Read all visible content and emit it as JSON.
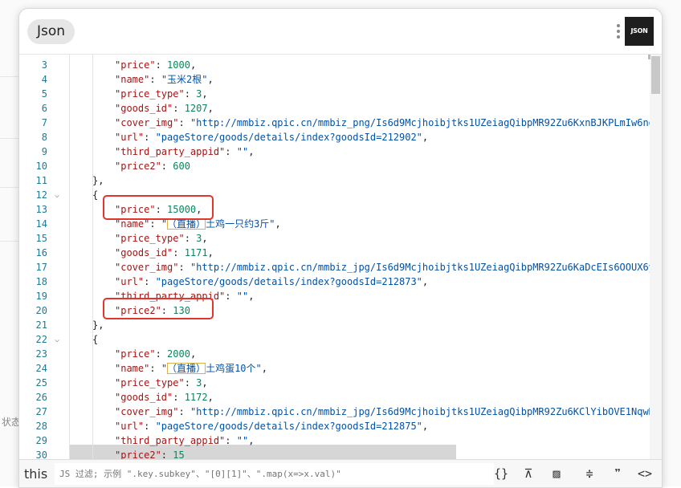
{
  "background": {
    "status_text": "状态"
  },
  "header": {
    "tab_label": "Json",
    "logo_text": "JSON"
  },
  "code_lines": [
    {
      "num": "3",
      "indent": 2,
      "tokens": [
        [
          "k",
          "\"price\""
        ],
        [
          "p",
          ": "
        ],
        [
          "n",
          "1000"
        ],
        [
          "p",
          ","
        ]
      ]
    },
    {
      "num": "4",
      "indent": 2,
      "tokens": [
        [
          "k",
          "\"name\""
        ],
        [
          "p",
          ": "
        ],
        [
          "s",
          "\"玉米2根\""
        ],
        [
          "p",
          ","
        ]
      ]
    },
    {
      "num": "5",
      "indent": 2,
      "tokens": [
        [
          "k",
          "\"price_type\""
        ],
        [
          "p",
          ": "
        ],
        [
          "n",
          "3"
        ],
        [
          "p",
          ","
        ]
      ]
    },
    {
      "num": "6",
      "indent": 2,
      "tokens": [
        [
          "k",
          "\"goods_id\""
        ],
        [
          "p",
          ": "
        ],
        [
          "n",
          "1207"
        ],
        [
          "p",
          ","
        ]
      ]
    },
    {
      "num": "7",
      "indent": 2,
      "tokens": [
        [
          "k",
          "\"cover_img\""
        ],
        [
          "p",
          ": "
        ],
        [
          "s",
          "\"http://mmbiz.qpic.cn/mmbiz_png/Is6d9Mcjhoibjtks1UZeiagQibpMR92Zu6KxnBJKPLmIw6nod"
        ]
      ]
    },
    {
      "num": "8",
      "indent": 2,
      "tokens": [
        [
          "k",
          "\"url\""
        ],
        [
          "p",
          ": "
        ],
        [
          "s",
          "\"pageStore/goods/details/index?goodsId=212902\""
        ],
        [
          "p",
          ","
        ]
      ]
    },
    {
      "num": "9",
      "indent": 2,
      "tokens": [
        [
          "k",
          "\"third_party_appid\""
        ],
        [
          "p",
          ": "
        ],
        [
          "s",
          "\"\""
        ],
        [
          "p",
          ","
        ]
      ]
    },
    {
      "num": "10",
      "indent": 2,
      "tokens": [
        [
          "k",
          "\"price2\""
        ],
        [
          "p",
          ": "
        ],
        [
          "n",
          "600"
        ]
      ]
    },
    {
      "num": "11",
      "indent": 1,
      "tokens": [
        [
          "p",
          "},"
        ]
      ]
    },
    {
      "num": "12",
      "indent": 1,
      "fold": true,
      "tokens": [
        [
          "p",
          "{"
        ]
      ]
    },
    {
      "num": "13",
      "indent": 2,
      "tokens": [
        [
          "k",
          "\"price\""
        ],
        [
          "p",
          ": "
        ],
        [
          "n",
          "15000"
        ],
        [
          "p",
          ","
        ]
      ]
    },
    {
      "num": "14",
      "indent": 2,
      "tokens": [
        [
          "k",
          "\"name\""
        ],
        [
          "p",
          ": "
        ],
        [
          "s",
          "\""
        ],
        [
          "sb",
          "（直播）"
        ],
        [
          "s",
          "土鸡一只约3斤\""
        ],
        [
          "p",
          ","
        ]
      ]
    },
    {
      "num": "15",
      "indent": 2,
      "tokens": [
        [
          "k",
          "\"price_type\""
        ],
        [
          "p",
          ": "
        ],
        [
          "n",
          "3"
        ],
        [
          "p",
          ","
        ]
      ]
    },
    {
      "num": "16",
      "indent": 2,
      "tokens": [
        [
          "k",
          "\"goods_id\""
        ],
        [
          "p",
          ": "
        ],
        [
          "n",
          "1171"
        ],
        [
          "p",
          ","
        ]
      ]
    },
    {
      "num": "17",
      "indent": 2,
      "tokens": [
        [
          "k",
          "\"cover_img\""
        ],
        [
          "p",
          ": "
        ],
        [
          "s",
          "\"http://mmbiz.qpic.cn/mmbiz_jpg/Is6d9Mcjhoibjtks1UZeiagQibpMR92Zu6KaDcEIs6OOUX6yq"
        ]
      ]
    },
    {
      "num": "18",
      "indent": 2,
      "tokens": [
        [
          "k",
          "\"url\""
        ],
        [
          "p",
          ": "
        ],
        [
          "s",
          "\"pageStore/goods/details/index?goodsId=212873\""
        ],
        [
          "p",
          ","
        ]
      ]
    },
    {
      "num": "19",
      "indent": 2,
      "tokens": [
        [
          "k",
          "\"third_party_appid\""
        ],
        [
          "p",
          ": "
        ],
        [
          "s",
          "\"\""
        ],
        [
          "p",
          ","
        ]
      ]
    },
    {
      "num": "20",
      "indent": 2,
      "tokens": [
        [
          "k",
          "\"price2\""
        ],
        [
          "p",
          ": "
        ],
        [
          "n",
          "130"
        ]
      ]
    },
    {
      "num": "21",
      "indent": 1,
      "tokens": [
        [
          "p",
          "},"
        ]
      ]
    },
    {
      "num": "22",
      "indent": 1,
      "fold": true,
      "tokens": [
        [
          "p",
          "{"
        ]
      ]
    },
    {
      "num": "23",
      "indent": 2,
      "tokens": [
        [
          "k",
          "\"price\""
        ],
        [
          "p",
          ": "
        ],
        [
          "n",
          "2000"
        ],
        [
          "p",
          ","
        ]
      ]
    },
    {
      "num": "24",
      "indent": 2,
      "tokens": [
        [
          "k",
          "\"name\""
        ],
        [
          "p",
          ": "
        ],
        [
          "s",
          "\""
        ],
        [
          "sb",
          "（直播）"
        ],
        [
          "s",
          "土鸡蛋10个\""
        ],
        [
          "p",
          ","
        ]
      ]
    },
    {
      "num": "25",
      "indent": 2,
      "tokens": [
        [
          "k",
          "\"price_type\""
        ],
        [
          "p",
          ": "
        ],
        [
          "n",
          "3"
        ],
        [
          "p",
          ","
        ]
      ]
    },
    {
      "num": "26",
      "indent": 2,
      "tokens": [
        [
          "k",
          "\"goods_id\""
        ],
        [
          "p",
          ": "
        ],
        [
          "n",
          "1172"
        ],
        [
          "p",
          ","
        ]
      ]
    },
    {
      "num": "27",
      "indent": 2,
      "tokens": [
        [
          "k",
          "\"cover_img\""
        ],
        [
          "p",
          ": "
        ],
        [
          "s",
          "\"http://mmbiz.qpic.cn/mmbiz_jpg/Is6d9Mcjhoibjtks1UZeiagQibpMR92Zu6KClYibOVE1NqwDxb"
        ]
      ]
    },
    {
      "num": "28",
      "indent": 2,
      "tokens": [
        [
          "k",
          "\"url\""
        ],
        [
          "p",
          ": "
        ],
        [
          "s",
          "\"pageStore/goods/details/index?goodsId=212875\""
        ],
        [
          "p",
          ","
        ]
      ]
    },
    {
      "num": "29",
      "indent": 2,
      "tokens": [
        [
          "k",
          "\"third_party_appid\""
        ],
        [
          "p",
          ": "
        ],
        [
          "s",
          "\"\""
        ],
        [
          "p",
          ","
        ]
      ]
    },
    {
      "num": "30",
      "indent": 2,
      "tokens": [
        [
          "k",
          "\"price2\""
        ],
        [
          "p",
          ": "
        ],
        [
          "n",
          "15"
        ]
      ]
    }
  ],
  "footer": {
    "this_label": "this",
    "filter_placeholder": "JS 过滤; 示例 \".key.subkey\"、\"[0][1]\"、\".map(x=>x.val)\"",
    "toolbar": {
      "braces": "{}",
      "filter_off": "⊼",
      "comment_off": "▨",
      "collapse": "≑",
      "quotes": "❞",
      "code": "<>"
    }
  }
}
